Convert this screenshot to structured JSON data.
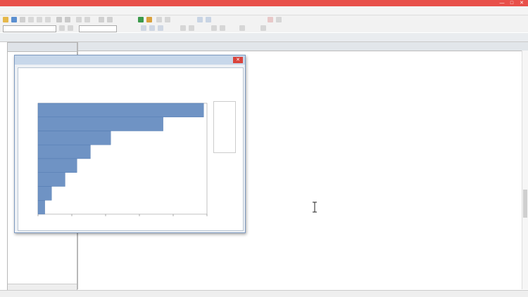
{
  "window": {
    "title": "",
    "controls": [
      "—",
      "□",
      "✕"
    ]
  },
  "menubar": {
    "items": [
      "",
      "",
      "",
      "",
      "",
      "",
      "",
      "",
      "",
      "",
      ""
    ]
  },
  "left_pane": {
    "header": ""
  },
  "main_pane": {
    "header": "",
    "lines": [
      {
        "a": "",
        "b": "",
        "c": ""
      },
      {
        "a": "",
        "b": "",
        "c": ""
      }
    ],
    "section": "",
    "table_headers": [
      "",
      ""
    ],
    "table_values": [
      "",
      ""
    ]
  },
  "dialog": {
    "title": "",
    "close": "✕",
    "chart": {
      "title": "",
      "subtitle": "",
      "xlabel": "",
      "legend": {
        "headers": [
          "",
          ""
        ],
        "rows": [
          [
            "",
            ""
          ],
          [
            "",
            ""
          ],
          [
            "",
            ""
          ],
          [
            "",
            ""
          ],
          [
            "",
            ""
          ],
          [
            "",
            ""
          ],
          [
            "",
            ""
          ],
          [
            "",
            ""
          ]
        ]
      }
    }
  },
  "chart_data": {
    "type": "bar",
    "orientation": "horizontal",
    "title": "",
    "xlabel": "",
    "categories": [
      "",
      "",
      "",
      "",
      "",
      "",
      "",
      ""
    ],
    "values": [
      0.98,
      0.74,
      0.43,
      0.31,
      0.23,
      0.16,
      0.08,
      0.04
    ],
    "xlim": [
      0,
      1
    ],
    "grid": false,
    "legend": "right",
    "bar_color": "#6f93c4"
  }
}
